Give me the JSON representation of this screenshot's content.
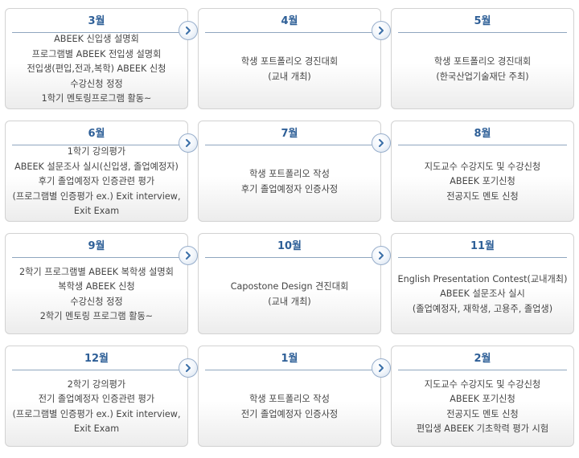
{
  "cards": [
    {
      "month": "3월",
      "lines": [
        "ABEEK 신입생 설명회",
        "프로그램별 ABEEK 전입생 설명회",
        "전입생(편입,전과,복학) ABEEK 신청",
        "수강신청 정정",
        "1학기 멘토링프로그램 활동~"
      ]
    },
    {
      "month": "4월",
      "lines": [
        "학생 포트폴리오 경진대회",
        "(교내 개최)"
      ]
    },
    {
      "month": "5월",
      "lines": [
        "학생 포트폴리오 경진대회",
        "(한국산업기술재단 주최)"
      ]
    },
    {
      "month": "6월",
      "lines": [
        "1학기 강의평가",
        "ABEEK 설문조사 실시(신입생, 졸업예정자)",
        "후기 졸업예정자 인증관련 평가",
        "(프로그램별 인증평가 ex.) Exit interview,",
        "Exit Exam"
      ]
    },
    {
      "month": "7월",
      "lines": [
        "학생 포트폴리오 작성",
        "후기 졸업예정자 인증사정"
      ]
    },
    {
      "month": "8월",
      "lines": [
        "지도교수 수강지도 및 수강신청",
        "ABEEK 포기신청",
        "전공지도 멘토 신청"
      ]
    },
    {
      "month": "9월",
      "lines": [
        "2학기 프로그램별 ABEEK 복학생 설명회",
        "복학생 ABEEK 신청",
        "수강신청 정정",
        "2학기 멘토링 프로그램 활동~"
      ]
    },
    {
      "month": "10월",
      "lines": [
        "Capostone Design 견진대회",
        "(교내 개최)"
      ]
    },
    {
      "month": "11월",
      "lines": [
        "English Presentation Contest(교내개최)",
        "ABEEK 설문조사 실시",
        "(졸업예정자, 재학생, 고용주, 졸업생)"
      ]
    },
    {
      "month": "12월",
      "lines": [
        "2학기 강의평가",
        "전기 졸업예정자 인증관련 평가",
        "(프로그램별 인증평가 ex.) Exit interview,",
        "Exit Exam"
      ]
    },
    {
      "month": "1월",
      "lines": [
        "학생 포트폴리오 작성",
        "전기 졸업예정자 인증사정"
      ]
    },
    {
      "month": "2월",
      "lines": [
        "지도교수 수강지도 및 수강신청",
        "ABEEK 포기신청",
        "전공지도 멘토 신청",
        "편입생 ABEEK 기초학력 평가 시험"
      ]
    }
  ],
  "icons": {
    "arrow": "chevron-right-icon"
  },
  "colors": {
    "month_text": "#2e5f97",
    "body_text": "#444444",
    "arrow": "#3a6fa8"
  }
}
